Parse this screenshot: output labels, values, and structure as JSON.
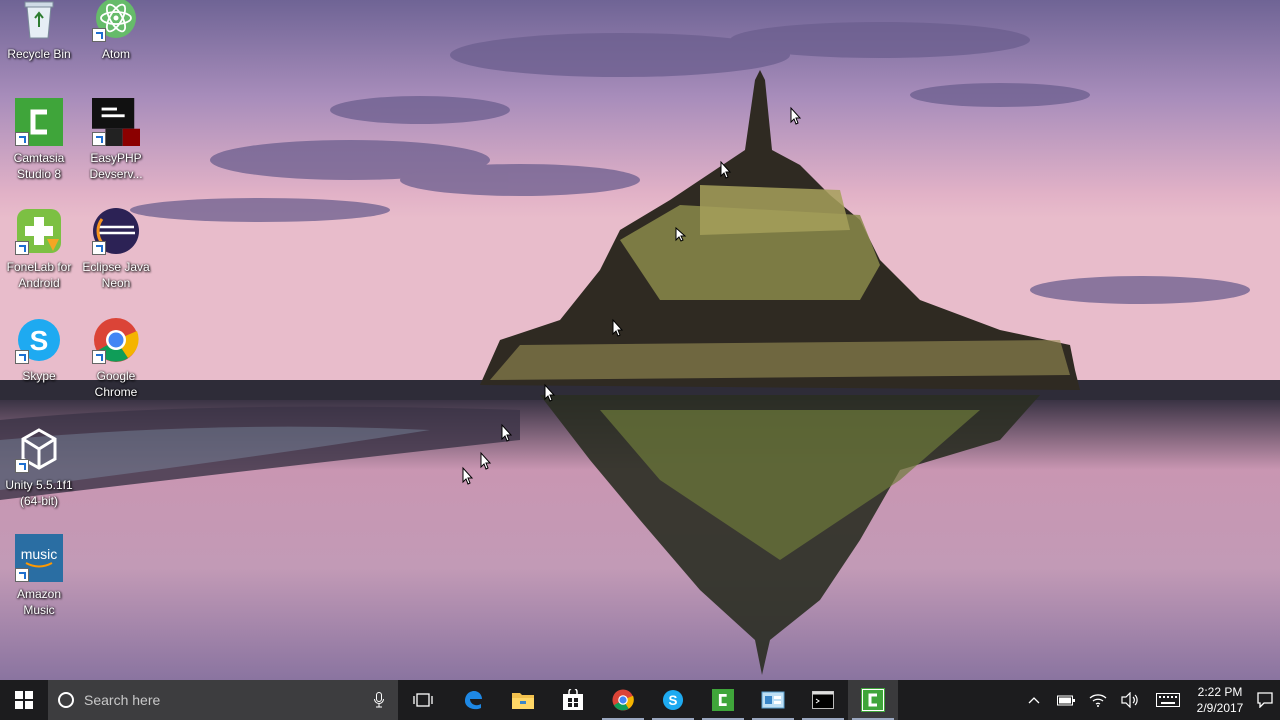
{
  "desktop": {
    "icons": [
      {
        "label": "Recycle Bin",
        "icon": "recycle-bin-icon",
        "shortcut": false
      },
      {
        "label": "Atom",
        "icon": "atom-icon",
        "shortcut": true
      },
      {
        "label": "Camtasia\nStudio 8",
        "icon": "camtasia-icon",
        "shortcut": true
      },
      {
        "label": "EasyPHP\nDevserv...",
        "icon": "easyphp-icon",
        "shortcut": true
      },
      {
        "label": "FoneLab for\nAndroid",
        "icon": "fonelab-icon",
        "shortcut": true
      },
      {
        "label": "Eclipse Java\nNeon",
        "icon": "eclipse-icon",
        "shortcut": true
      },
      {
        "label": "Skype",
        "icon": "skype-icon",
        "shortcut": true
      },
      {
        "label": "Google\nChrome",
        "icon": "chrome-icon",
        "shortcut": true
      },
      {
        "label": "Unity 5.5.1f1\n(64-bit)",
        "icon": "unity-icon",
        "shortcut": true
      },
      {
        "label": "Amazon\nMusic",
        "icon": "amazon-music-icon",
        "shortcut": true
      }
    ],
    "amazon_music_tile_text": "music"
  },
  "taskbar": {
    "search_placeholder": "Search here",
    "pinned": [
      {
        "name": "task-view",
        "icon": "task-view-icon"
      },
      {
        "name": "edge",
        "icon": "edge-icon"
      },
      {
        "name": "file-explorer",
        "icon": "folder-icon"
      },
      {
        "name": "store",
        "icon": "store-icon"
      },
      {
        "name": "chrome",
        "icon": "chrome-icon"
      },
      {
        "name": "skype",
        "icon": "skype-icon"
      },
      {
        "name": "camtasia",
        "icon": "camtasia-icon"
      },
      {
        "name": "control-panel",
        "icon": "control-panel-icon"
      },
      {
        "name": "command-prompt",
        "icon": "terminal-icon"
      },
      {
        "name": "camtasia-recorder",
        "icon": "camtasia-icon"
      }
    ],
    "clock": {
      "time": "2:22 PM",
      "date": "2/9/2017"
    }
  },
  "colors": {
    "taskbar": "#1c1c1e",
    "search_bg": "#3d3d3f",
    "camtasia": "#3fa53a",
    "atom": "#66bb6a",
    "skype": "#1eaaf1",
    "eclipse": "#2c2255",
    "amazon_music": "#2a6ea3"
  }
}
